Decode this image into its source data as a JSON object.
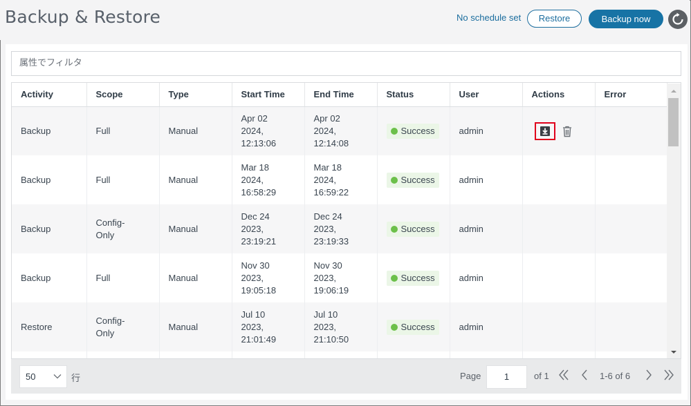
{
  "header": {
    "title": "Backup & Restore",
    "schedule_status": "No schedule set",
    "restore_label": "Restore",
    "backup_now_label": "Backup now"
  },
  "filter": {
    "placeholder": "属性でフィルタ"
  },
  "table": {
    "columns": [
      "Activity",
      "Scope",
      "Type",
      "Start Time",
      "End Time",
      "Status",
      "User",
      "Actions",
      "Error"
    ],
    "rows": [
      {
        "activity": "Backup",
        "scope": "Full",
        "type": "Manual",
        "start": [
          "Apr 02",
          "2024,",
          "12:13:06"
        ],
        "end": [
          "Apr 02",
          "2024,",
          "12:14:08"
        ],
        "status": "Success",
        "user": "admin",
        "error": ""
      },
      {
        "activity": "Backup",
        "scope": "Full",
        "type": "Manual",
        "start": [
          "Mar 18",
          "2024,",
          "16:58:29"
        ],
        "end": [
          "Mar 18",
          "2024,",
          "16:59:22"
        ],
        "status": "Success",
        "user": "admin",
        "error": ""
      },
      {
        "activity": "Backup",
        "scope": [
          "Config-",
          "Only"
        ],
        "type": "Manual",
        "start": [
          "Dec 24",
          "2023,",
          "23:19:21"
        ],
        "end": [
          "Dec 24",
          "2023,",
          "23:19:33"
        ],
        "status": "Success",
        "user": "admin",
        "error": ""
      },
      {
        "activity": "Backup",
        "scope": "Full",
        "type": "Manual",
        "start": [
          "Nov 30",
          "2023,",
          "19:05:18"
        ],
        "end": [
          "Nov 30",
          "2023,",
          "19:06:19"
        ],
        "status": "Success",
        "user": "admin",
        "error": ""
      },
      {
        "activity": "Restore",
        "scope": [
          "Config-",
          "Only"
        ],
        "type": "Manual",
        "start": [
          "Jul 10",
          "2023,",
          "21:01:49"
        ],
        "end": [
          "Jul 10",
          "2023,",
          "21:10:50"
        ],
        "status": "Success",
        "user": "admin",
        "error": ""
      }
    ]
  },
  "pagination": {
    "page_size": "50",
    "rows_label": "行",
    "page_label": "Page",
    "current_page": "1",
    "of_label": "of",
    "total_pages": "1",
    "range": "1-6 of 6"
  },
  "colors": {
    "primary": "#1773a5",
    "success_dot": "#6cc04a",
    "success_bg": "#ebf6e7",
    "highlight_border": "#e0001b"
  },
  "icons": {
    "refresh": "refresh-icon",
    "download": "download-icon",
    "delete": "trash-icon",
    "first": "first-page-icon",
    "prev": "prev-page-icon",
    "next": "next-page-icon",
    "last": "last-page-icon",
    "dropdown": "chevron-down-icon"
  }
}
